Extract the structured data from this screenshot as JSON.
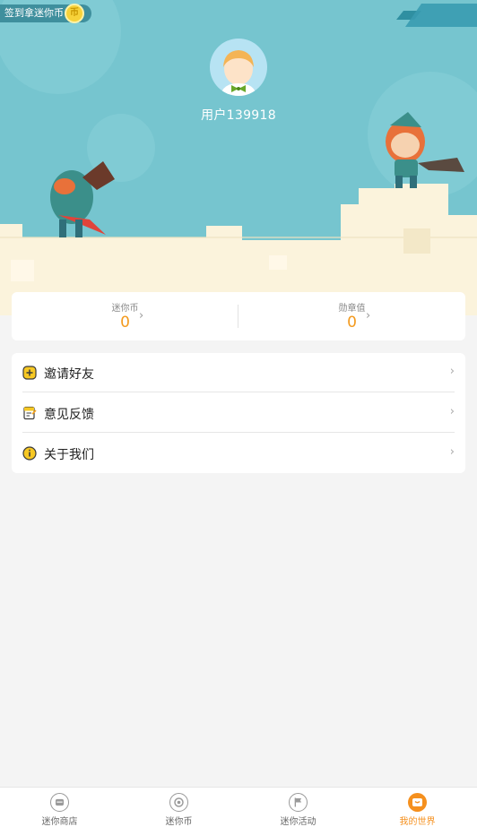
{
  "signin": {
    "label": "签到拿迷你币",
    "coin_icon": "coin-icon"
  },
  "profile": {
    "username": "用户139918",
    "avatar_icon": "avatar-icon"
  },
  "stats": [
    {
      "label": "迷你币",
      "value": "0"
    },
    {
      "label": "勋章值",
      "value": "0"
    }
  ],
  "menu": [
    {
      "label": "邀请好友",
      "icon": "invite-plus-icon"
    },
    {
      "label": "意见反馈",
      "icon": "feedback-note-icon"
    },
    {
      "label": "关于我们",
      "icon": "info-icon"
    }
  ],
  "nav": [
    {
      "label": "迷你商店",
      "icon": "store-icon",
      "active": false
    },
    {
      "label": "迷你币",
      "icon": "coin-icon",
      "active": false
    },
    {
      "label": "迷你活动",
      "icon": "flag-icon",
      "active": false
    },
    {
      "label": "我的世界",
      "icon": "my-world-icon",
      "active": true
    }
  ],
  "colors": {
    "hero_bg": "#76c5cf",
    "accent": "#f5901e",
    "value": "#f39a1e"
  }
}
